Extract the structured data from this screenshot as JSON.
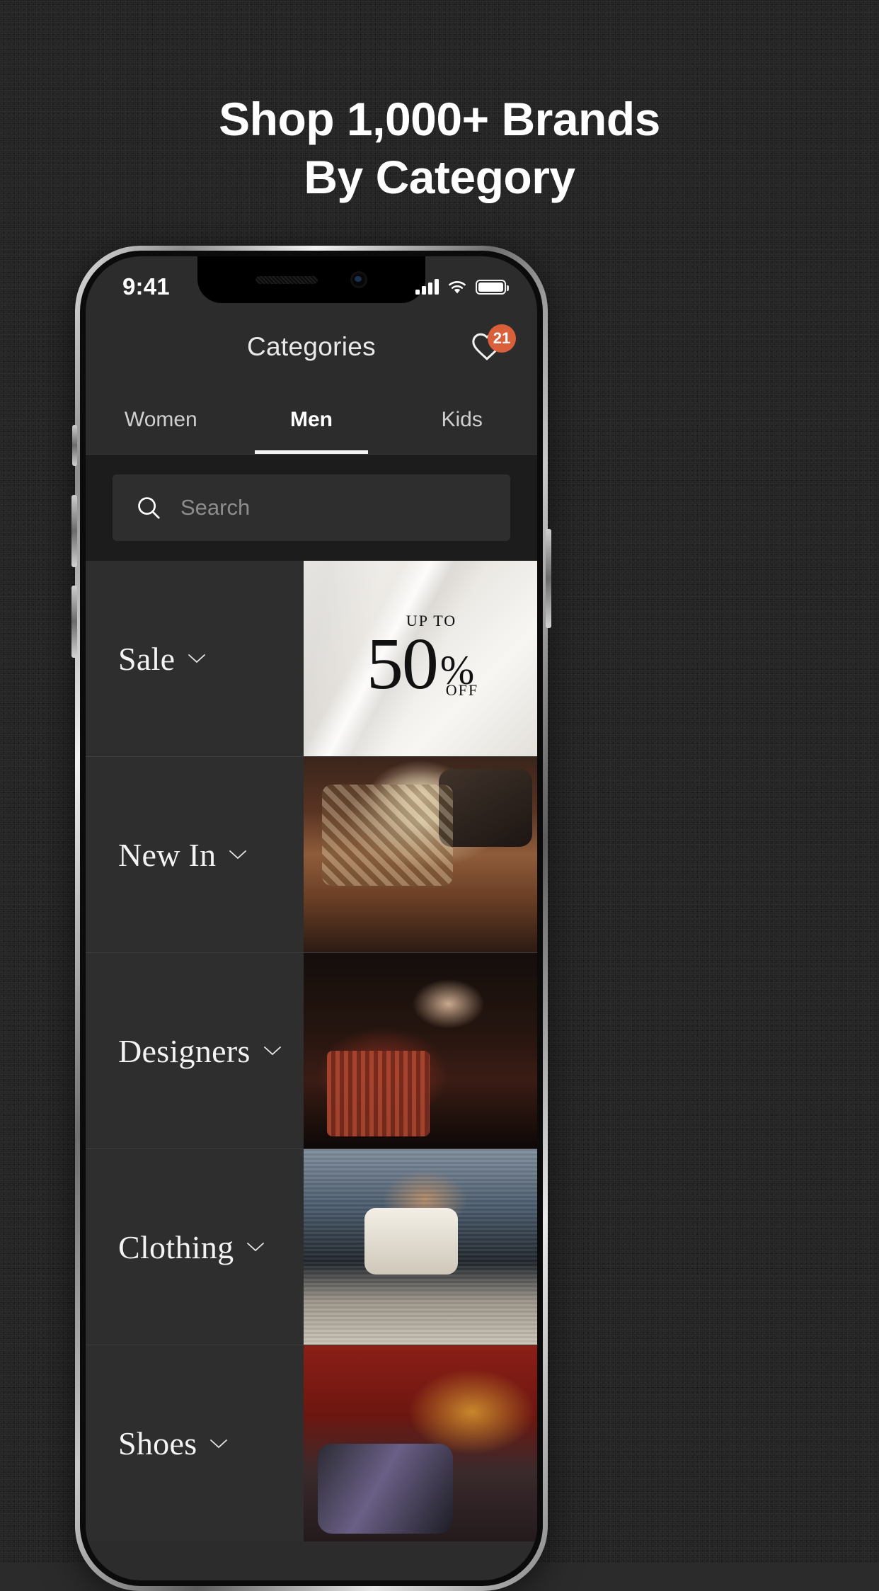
{
  "promo_heading": {
    "line1": "Shop 1,000+ Brands",
    "line2": "By Category"
  },
  "status_bar": {
    "time": "9:41",
    "signal_icon": "cellular-signal-icon",
    "wifi_icon": "wifi-icon",
    "battery_icon": "battery-full-icon"
  },
  "header": {
    "title": "Categories",
    "favorites_icon": "heart-icon",
    "favorites_count": "21",
    "badge_color": "#d9603b"
  },
  "tabs": [
    {
      "label": "Women",
      "active": false
    },
    {
      "label": "Men",
      "active": true
    },
    {
      "label": "Kids",
      "active": false
    }
  ],
  "search": {
    "icon": "search-icon",
    "placeholder": "Search",
    "value": ""
  },
  "categories": [
    {
      "label": "Sale",
      "chevron_icon": "chevron-down-icon",
      "thumb": "up-to-50-percent-off-promo"
    },
    {
      "label": "New In",
      "chevron_icon": "chevron-down-icon",
      "thumb": "mens-plaid-jacket-photo"
    },
    {
      "label": "Designers",
      "chevron_icon": "chevron-down-icon",
      "thumb": "mens-black-leather-photo"
    },
    {
      "label": "Clothing",
      "chevron_icon": "chevron-down-icon",
      "thumb": "mens-white-sweater-photo"
    },
    {
      "label": "Shoes",
      "chevron_icon": "chevron-down-icon",
      "thumb": "mens-sneakers-photo"
    }
  ],
  "sale_promo": {
    "up_to": "UP TO",
    "number": "50",
    "percent": "%",
    "off": "OFF"
  },
  "theme": {
    "background": "#2a2a2a",
    "screen_bg": "#2c2c2c",
    "row_bg": "#2e2e2e",
    "search_bg": "#1c1c1c",
    "text": "#ffffff"
  }
}
